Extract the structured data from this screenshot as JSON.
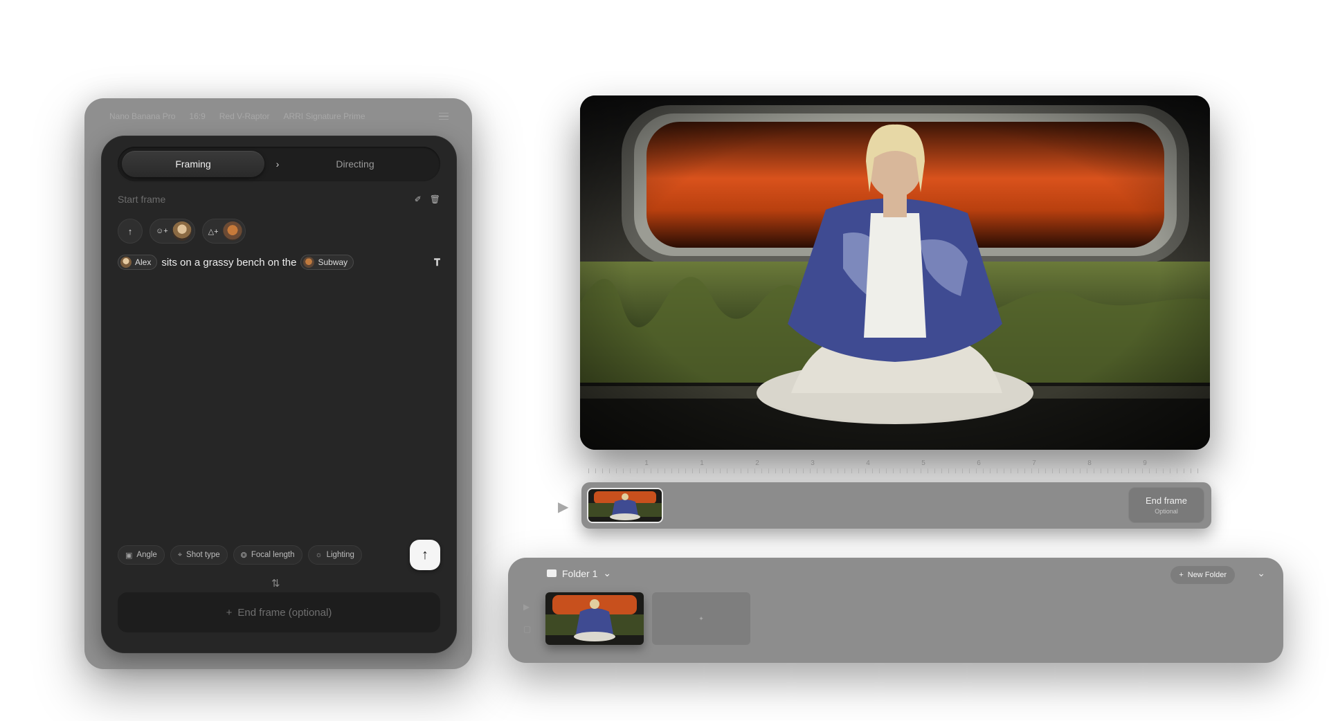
{
  "topbar": {
    "items": [
      "Nano Banana Pro",
      "16:9",
      "Red V-Raptor",
      "ARRI Signature Prime"
    ]
  },
  "tabs": {
    "framing": "Framing",
    "directing": "Directing"
  },
  "start_frame": {
    "label": "Start frame"
  },
  "prompt": {
    "mention_character": "Alex",
    "text": "sits on a grassy bench on the",
    "mention_location": "Subway"
  },
  "options": {
    "angle": "Angle",
    "shot_type": "Shot type",
    "focal_length": "Focal length",
    "lighting": "Lighting"
  },
  "end_frame_input": {
    "label": "End frame (optional)"
  },
  "timeline": {
    "ruler": [
      "1",
      "1",
      "2",
      "3",
      "4",
      "5",
      "6",
      "7",
      "8",
      "9"
    ],
    "end_frame_title": "End frame",
    "end_frame_sub": "Optional"
  },
  "folder": {
    "name": "Folder 1",
    "new_folder": "New Folder"
  },
  "colors": {
    "panel_outer": "#8f8f8f",
    "panel_inner": "#262626",
    "accent_white": "#f5f5f5",
    "window_glow": "#d9521c"
  }
}
